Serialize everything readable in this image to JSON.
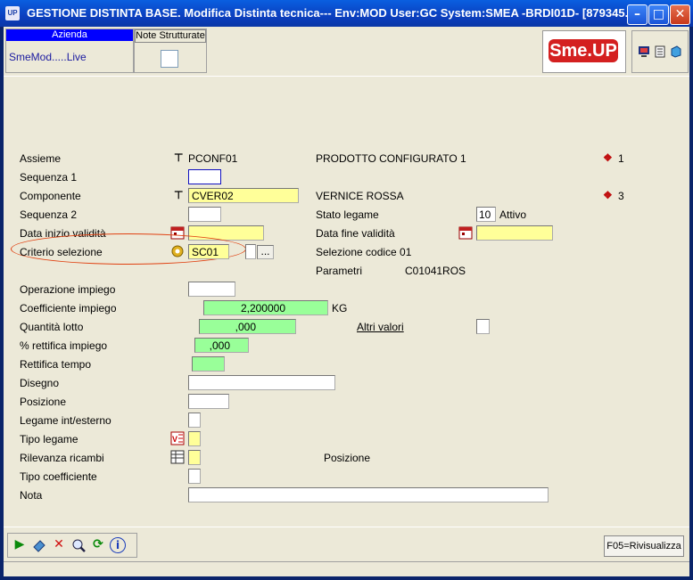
{
  "window": {
    "title": "GESTIONE DISTINTA BASE.  Modifica Distinta tecnica--- Env:MOD User:GC System:SMEA -BRDI01D- [879345...",
    "app_icon": "UP"
  },
  "header": {
    "azienda_label": "Azienda",
    "azienda_value": "SmeMod.....Live",
    "note_label": "Note Strutturate",
    "logo_left": "Sme.",
    "logo_right": "UP"
  },
  "form": {
    "assieme": {
      "label": "Assieme",
      "code": "PCONF01",
      "description": "PRODOTTO CONFIGURATO 1",
      "count": "1"
    },
    "sequenza1": {
      "label": "Sequenza 1",
      "value": ""
    },
    "componente": {
      "label": "Componente",
      "code": "CVER02",
      "description": "VERNICE ROSSA",
      "count": "3"
    },
    "sequenza2": {
      "label": "Sequenza 2",
      "value": ""
    },
    "stato_legame": {
      "label": "Stato legame",
      "value": "10",
      "text": "Attivo"
    },
    "data_inizio": {
      "label": "Data inizio validità",
      "value": ""
    },
    "data_fine": {
      "label": "Data fine validità",
      "value": ""
    },
    "criterio": {
      "label": "Criterio selezione",
      "value": "SC01",
      "button": "...",
      "description": "Selezione codice 01"
    },
    "parametri": {
      "label": "Parametri",
      "value": "C01041ROS"
    },
    "operazione": {
      "label": "Operazione impiego",
      "value": ""
    },
    "coefficiente": {
      "label": "Coefficiente impiego",
      "value": "2,200000",
      "unit": "KG"
    },
    "quantita": {
      "label": "Quantità lotto",
      "value": ",000"
    },
    "altri_valori": {
      "label": "Altri valori"
    },
    "rettifica_pct": {
      "label": "% rettifica impiego",
      "value": ",000"
    },
    "rettifica_tempo": {
      "label": "Rettifica tempo",
      "value": ""
    },
    "disegno": {
      "label": "Disegno",
      "value": ""
    },
    "posizione": {
      "label": "Posizione",
      "value": ""
    },
    "legame": {
      "label": "Legame int/esterno",
      "value": ""
    },
    "tipo_legame": {
      "label": "Tipo legame",
      "value": ""
    },
    "rilevanza": {
      "label": "Rilevanza ricambi",
      "value": "",
      "text": "Posizione"
    },
    "tipo_coeff": {
      "label": "Tipo coefficiente",
      "value": ""
    },
    "nota": {
      "label": "Nota",
      "value": ""
    }
  },
  "toolbar": {
    "f05": "F05=Rivisualizza"
  },
  "colors": {
    "yellow_field": "#ffff99",
    "green_field": "#99ff99",
    "header_blue": "#0000ff",
    "highlight_ellipse": "#e04010"
  }
}
